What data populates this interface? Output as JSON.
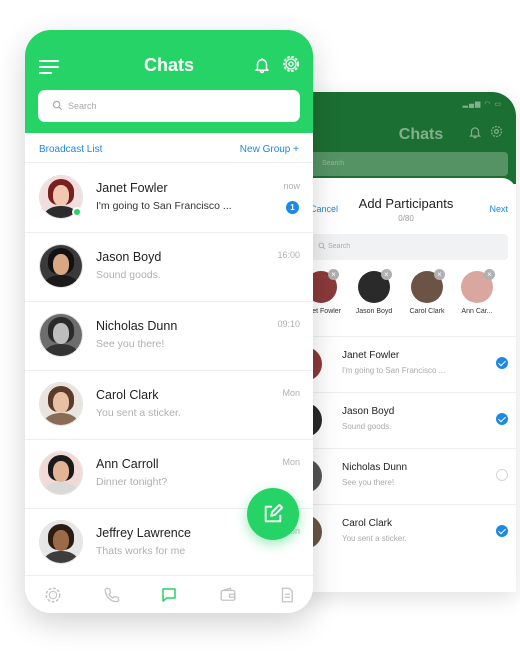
{
  "front": {
    "title": "Chats",
    "search_placeholder": "Search",
    "broadcast_label": "Broadcast List",
    "new_group_label": "New Group +",
    "chats": [
      {
        "name": "Janet Fowler",
        "message": "I'm going to San Francisco ...",
        "time": "now",
        "unread": "1",
        "online": true
      },
      {
        "name": "Jason Boyd",
        "message": "Sound goods.",
        "time": "16:00"
      },
      {
        "name": "Nicholas Dunn",
        "message": "See you there!",
        "time": "09:10"
      },
      {
        "name": "Carol Clark",
        "message": "You sent a sticker.",
        "time": "Mon"
      },
      {
        "name": "Ann Carroll",
        "message": "Dinner tonight?",
        "time": "Mon"
      },
      {
        "name": "Jeffrey Lawrence",
        "message": "Thats works for me",
        "time": "Mon"
      }
    ],
    "tabs": [
      "status-icon",
      "calls-icon",
      "chats-icon",
      "wallet-icon",
      "notes-icon"
    ],
    "active_tab": "chats-icon"
  },
  "back": {
    "title": "Chats",
    "search_placeholder": "Search",
    "sheet": {
      "cancel_label": "Cancel",
      "title": "Add Participants",
      "count": "0/80",
      "next_label": "Next",
      "search_placeholder": "Search",
      "selected": [
        "Janet Fowler",
        "Jason Boyd",
        "Carol Clark",
        "Ann Car..."
      ],
      "participants": [
        {
          "name": "Janet Fowler",
          "message": "I'm going to San Francisco ...",
          "checked": true
        },
        {
          "name": "Jason Boyd",
          "message": "Sound goods.",
          "checked": true
        },
        {
          "name": "Nicholas Dunn",
          "message": "See you there!",
          "checked": false
        },
        {
          "name": "Carol Clark",
          "message": "You sent a sticker.",
          "checked": true
        }
      ]
    }
  },
  "colors": {
    "brand_green": "#25d366",
    "dark_green": "#1c6f32",
    "link_blue": "#1e88e5"
  }
}
